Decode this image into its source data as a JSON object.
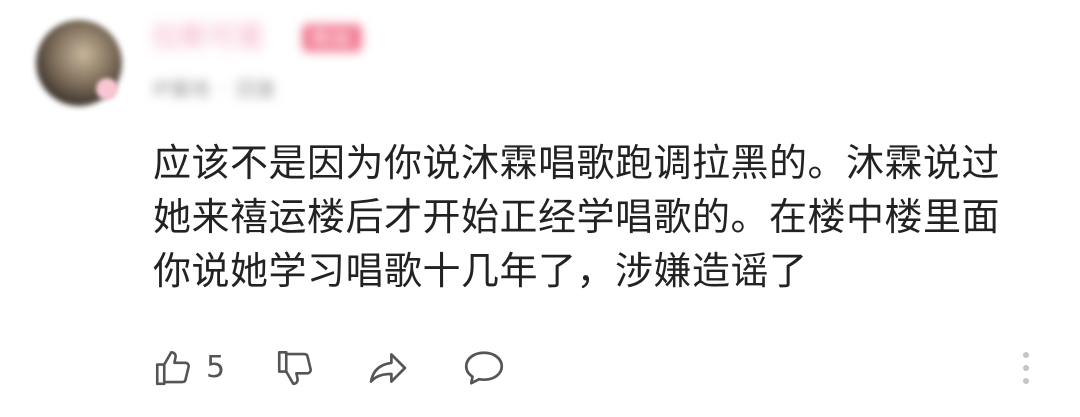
{
  "comment": {
    "username": "拉斯可是",
    "user_tag": "粉丝",
    "meta": {
      "ip_location": "IP属地",
      "date": "",
      "reply_label": "回复"
    },
    "text_lines": [
      "应该不是因为你说沐霖唱歌跑调拉黑的。沐霖说过",
      "她来禧运楼后才开始正经学唱歌的。在楼中楼里面",
      "你说她学习唱歌十几年了，涉嫌造谣了"
    ],
    "actions": {
      "like_count": "5"
    }
  },
  "colors": {
    "text": "#222222",
    "icon": "#555555",
    "username": "#f3a9c0",
    "tag_bg": "#f27b93"
  },
  "icons": [
    "thumbs-up-icon",
    "thumbs-down-icon",
    "share-icon",
    "comment-icon",
    "more-vertical-icon"
  ]
}
